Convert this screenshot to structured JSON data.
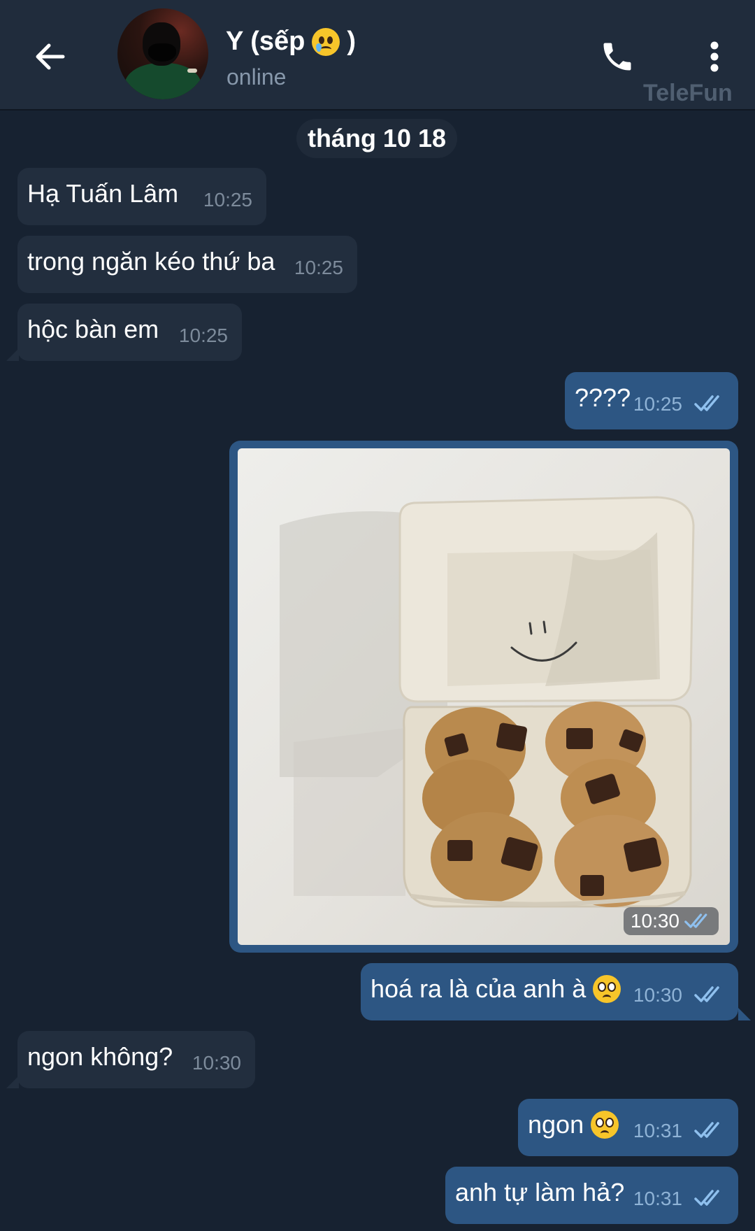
{
  "header": {
    "title": "Y (sếp",
    "title_close": ")",
    "title_emoji": "crying-face-emoji",
    "status": "online",
    "watermark": "TeleFun",
    "icons": [
      "arrow-left-icon",
      "phone-icon",
      "more-vertical-icon"
    ]
  },
  "date_chip": "tháng 10 18",
  "messages": [
    {
      "direction": "in",
      "text": "Hạ Tuấn Lâm",
      "time": "10:25"
    },
    {
      "direction": "in",
      "text": "trong ngăn kéo thứ ba",
      "time": "10:25"
    },
    {
      "direction": "in",
      "text": "hộc bàn em",
      "time": "10:25"
    },
    {
      "direction": "out",
      "text": "????",
      "time": "10:25",
      "status": "read"
    },
    {
      "direction": "out",
      "type": "photo",
      "photo": "box-of-chocolate-chip-cookies",
      "time": "10:30",
      "status": "read"
    },
    {
      "direction": "out",
      "text": "hoá ra là của anh à",
      "emoji": "pleading-face-emoji",
      "time": "10:30",
      "status": "read"
    },
    {
      "direction": "in",
      "text": "ngon không?",
      "time": "10:30"
    },
    {
      "direction": "out",
      "text": "ngon",
      "emoji": "pleading-face-emoji",
      "time": "10:31",
      "status": "read"
    },
    {
      "direction": "out",
      "text": "anh tự làm hả?",
      "time": "10:31",
      "status": "read"
    }
  ],
  "colors": {
    "background": "#172231",
    "header": "#202c3c",
    "incoming_bubble": "#222e3e",
    "outgoing_bubble": "#2d5683",
    "read_check": "#8fc0ee"
  }
}
